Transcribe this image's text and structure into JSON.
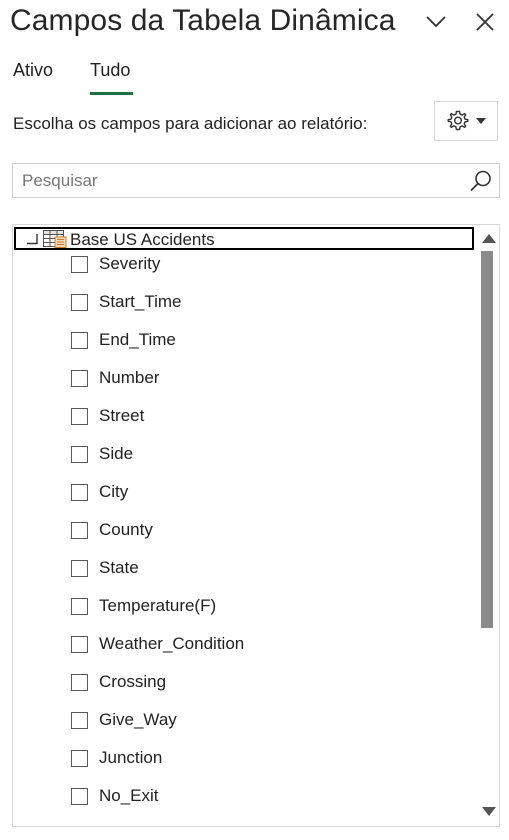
{
  "header": {
    "title": "Campos da Tabela Dinâmica"
  },
  "tabs": [
    {
      "label": "Ativo",
      "active": false
    },
    {
      "label": "Tudo",
      "active": true
    }
  ],
  "instruction": "Escolha os campos para adicionar ao relatório:",
  "search": {
    "placeholder": "Pesquisar",
    "value": ""
  },
  "field_list": {
    "table_name": "Base US Accidents",
    "fields": [
      {
        "label": "Severity",
        "checked": false
      },
      {
        "label": "Start_Time",
        "checked": false
      },
      {
        "label": "End_Time",
        "checked": false
      },
      {
        "label": "Number",
        "checked": false
      },
      {
        "label": "Street",
        "checked": false
      },
      {
        "label": "Side",
        "checked": false
      },
      {
        "label": "City",
        "checked": false
      },
      {
        "label": "County",
        "checked": false
      },
      {
        "label": "State",
        "checked": false
      },
      {
        "label": "Temperature(F)",
        "checked": false
      },
      {
        "label": "Weather_Condition",
        "checked": false
      },
      {
        "label": "Crossing",
        "checked": false
      },
      {
        "label": "Give_Way",
        "checked": false
      },
      {
        "label": "Junction",
        "checked": false
      },
      {
        "label": "No_Exit",
        "checked": false
      }
    ]
  },
  "icons": {
    "collapse": "chevron-down-icon",
    "close": "close-icon",
    "settings": "gear-icon",
    "search": "search-icon",
    "table": "table-icon"
  },
  "colors": {
    "accent": "#1f7145",
    "scroll_thumb": "#8a8a8a",
    "text": "#222222"
  }
}
